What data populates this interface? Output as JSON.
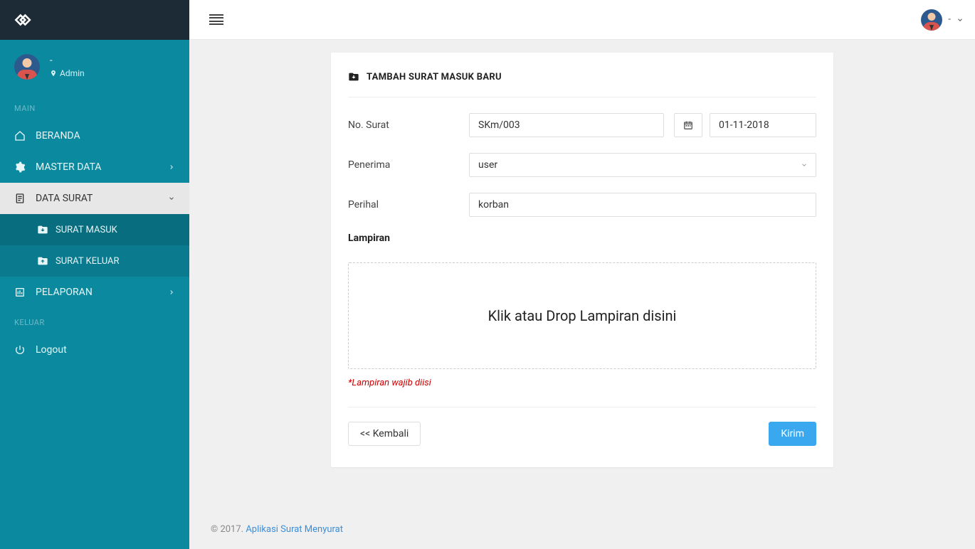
{
  "sidebar": {
    "user_name": "-",
    "user_role": "Admin",
    "sections": {
      "main": "MAIN",
      "keluar": "KELUAR"
    },
    "items": {
      "beranda": "BERANDA",
      "master_data": "MASTER DATA",
      "data_surat": "DATA SURAT",
      "pelaporan": "PELAPORAN",
      "logout": "Logout"
    },
    "sub_items": {
      "surat_masuk": "SURAT MASUK",
      "surat_keluar": "SURAT KELUAR"
    }
  },
  "topbar": {
    "user_label": "-"
  },
  "form": {
    "title": "TAMBAH SURAT MASUK BARU",
    "labels": {
      "no_surat": "No. Surat",
      "penerima": "Penerima",
      "perihal": "Perihal",
      "lampiran": "Lampiran"
    },
    "values": {
      "no_surat": "SKm/003",
      "tanggal": "01-11-2018",
      "penerima": "user",
      "perihal": "korban"
    },
    "dropzone": "Klik atau Drop Lampiran disini",
    "lampiran_note": "*Lampiran wajib diisi",
    "buttons": {
      "kembali": "<< Kembali",
      "kirim": "Kirim"
    }
  },
  "footer": {
    "copyright": "© 2017. ",
    "link": "Aplikasi Surat Menyurat"
  }
}
